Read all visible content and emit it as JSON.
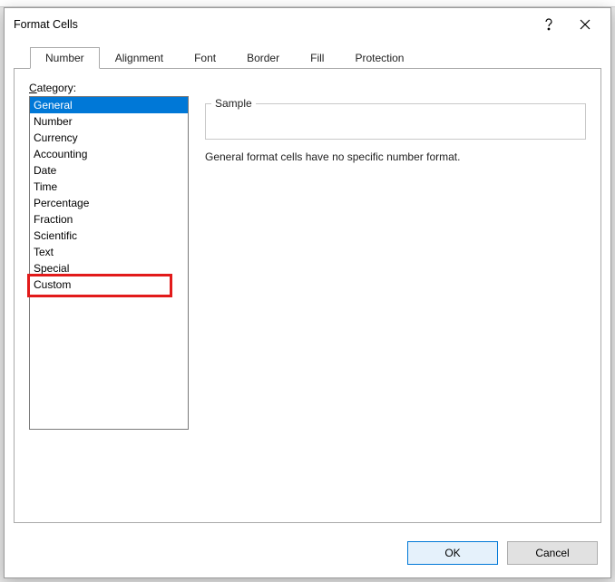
{
  "dialog": {
    "title": "Format Cells"
  },
  "tabs": [
    {
      "label": "Number"
    },
    {
      "label": "Alignment"
    },
    {
      "label": "Font"
    },
    {
      "label": "Border"
    },
    {
      "label": "Fill"
    },
    {
      "label": "Protection"
    }
  ],
  "category": {
    "label": "Category:",
    "items": [
      "General",
      "Number",
      "Currency",
      "Accounting",
      "Date",
      "Time",
      "Percentage",
      "Fraction",
      "Scientific",
      "Text",
      "Special",
      "Custom"
    ],
    "selected": "General",
    "highlighted": "Custom"
  },
  "sample": {
    "legend": "Sample",
    "value": ""
  },
  "description": "General format cells have no specific number format.",
  "buttons": {
    "ok": "OK",
    "cancel": "Cancel"
  }
}
